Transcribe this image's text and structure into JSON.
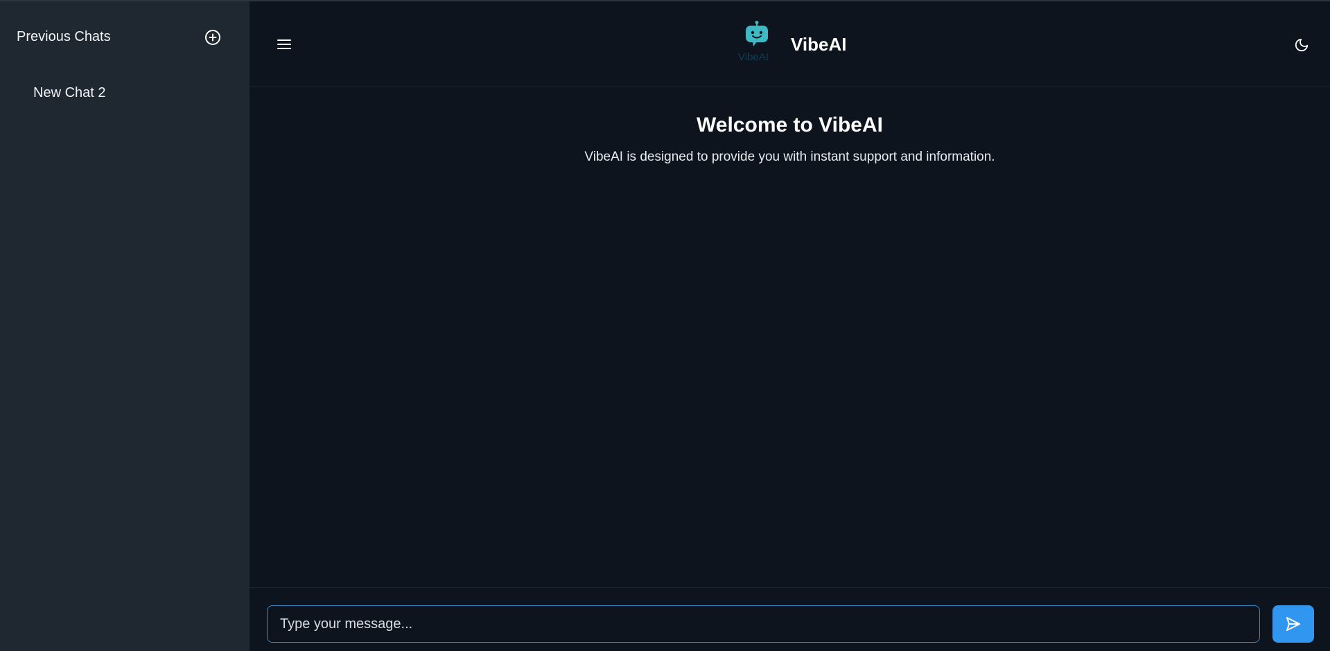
{
  "sidebar": {
    "header": "Previous Chats",
    "new_chat_icon": "plus-circle-icon",
    "chats": [
      {
        "label": "New Chat 2"
      }
    ]
  },
  "header": {
    "menu_icon": "hamburger-menu-icon",
    "logo_text": "VibeAI",
    "title": "VibeAI",
    "theme_icon": "moon-icon"
  },
  "welcome": {
    "title": "Welcome to VibeAI",
    "subtitle": "VibeAI is designed to provide you with instant support and information."
  },
  "composer": {
    "placeholder": "Type your message...",
    "value": "",
    "send_icon": "send-icon"
  },
  "colors": {
    "sidebar_bg": "#1f2731",
    "main_bg": "#0d141d",
    "accent": "#3196f0",
    "logo_teal": "#3fb9c4"
  }
}
